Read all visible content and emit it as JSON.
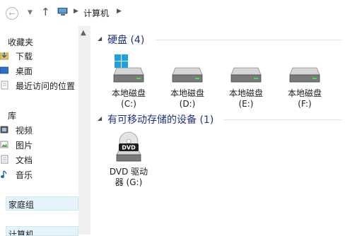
{
  "address_bar": {
    "breadcrumb": [
      "计算机"
    ]
  },
  "sidebar": {
    "favorites_header": "收藏夹",
    "favorites": [
      {
        "label": "下载",
        "icon": "download-folder-icon"
      },
      {
        "label": "桌面",
        "icon": "desktop-icon"
      },
      {
        "label": "最近访问的位置",
        "icon": "recent-places-icon"
      }
    ],
    "libraries_header": "库",
    "libraries": [
      {
        "label": "视频",
        "icon": "videos-library-icon"
      },
      {
        "label": "图片",
        "icon": "pictures-library-icon"
      },
      {
        "label": "文档",
        "icon": "documents-library-icon"
      },
      {
        "label": "音乐",
        "icon": "music-library-icon"
      }
    ],
    "homegroup": "家庭组",
    "computer": "计算机"
  },
  "main": {
    "hard_drives_group": "硬盘 (4)",
    "drives": [
      {
        "name": "本地磁盘",
        "letter": "(C:)",
        "icon": "system-drive-icon"
      },
      {
        "name": "本地磁盘",
        "letter": "(D:)",
        "icon": "hard-drive-icon"
      },
      {
        "name": "本地磁盘",
        "letter": "(E:)",
        "icon": "hard-drive-icon"
      },
      {
        "name": "本地磁盘",
        "letter": "(F:)",
        "icon": "hard-drive-icon"
      }
    ],
    "removable_group": "有可移动存储的设备 (1)",
    "removable": [
      {
        "name": "DVD 驱动",
        "letter": "器 (G:)",
        "icon": "dvd-drive-icon",
        "badge": "DVD"
      }
    ]
  },
  "colors": {
    "group_title": "#1e3287",
    "selection": "#e5f3fb",
    "windows_logo": "#1ba1e2"
  }
}
